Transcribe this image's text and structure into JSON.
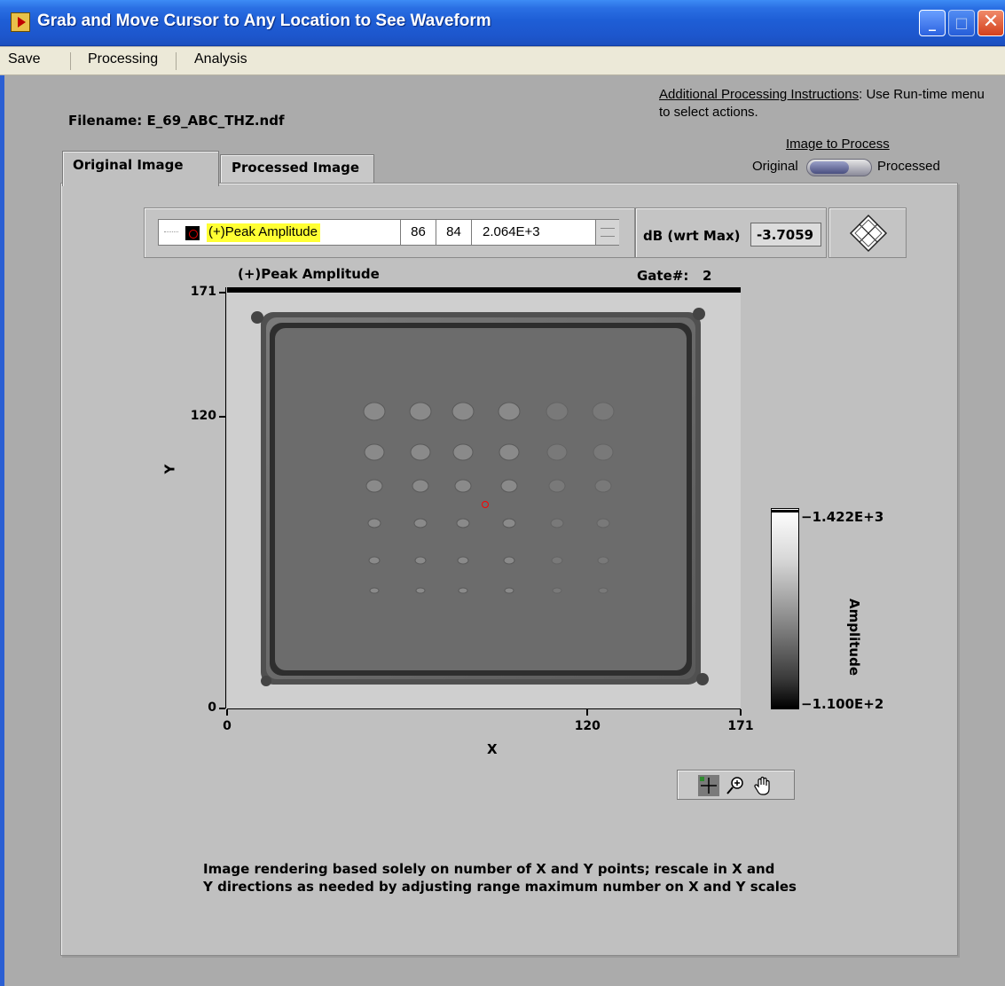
{
  "window": {
    "title": "Grab and Move Cursor to Any Location to See Waveform",
    "min_glyph": "_",
    "max_glyph": "□",
    "close_glyph": "✕"
  },
  "menu": [
    "Save",
    "Processing",
    "Analysis"
  ],
  "filename": {
    "label": "Filename:  E_69_ABC_THZ.ndf"
  },
  "instructions": {
    "heading": "Additional Processing Instructions",
    "text": ": Use Run-time menu to select actions."
  },
  "image_to_process": {
    "title": "Image to Process",
    "left": "Original",
    "right": "Processed",
    "value": "Original"
  },
  "tabs": {
    "active": "Original Image",
    "inactive": "Processed Image"
  },
  "cursor": {
    "name": "(+)Peak Amplitude",
    "x": "86",
    "y": "84",
    "value": "2.064E+3",
    "color": "#ff0000"
  },
  "db": {
    "label": "dB (wrt Max)",
    "value": "-3.7059"
  },
  "plot": {
    "title": "(+)Peak Amplitude",
    "gate_label": "Gate#:",
    "gate_value": "2",
    "xlabel": "X",
    "ylabel": "Y",
    "xticks": [
      "0",
      "120",
      "171"
    ],
    "yticks": [
      "171",
      "120",
      "0"
    ],
    "xlim": [
      0,
      171
    ],
    "ylim": [
      0,
      171
    ],
    "cursor_point": [
      86,
      84
    ]
  },
  "colorbar": {
    "max": "1.422E+3",
    "min": "1.100E+2",
    "label": "Amplitude",
    "colormap": "grayscale"
  },
  "palette_icons": [
    "cursor-move-icon",
    "zoom-icon",
    "pan-hand-icon"
  ],
  "note": {
    "line1": "Image rendering based solely on number of X and Y points; rescale in X and",
    "line2": "Y directions as needed by adjusting range maximum number on X and Y scales"
  }
}
